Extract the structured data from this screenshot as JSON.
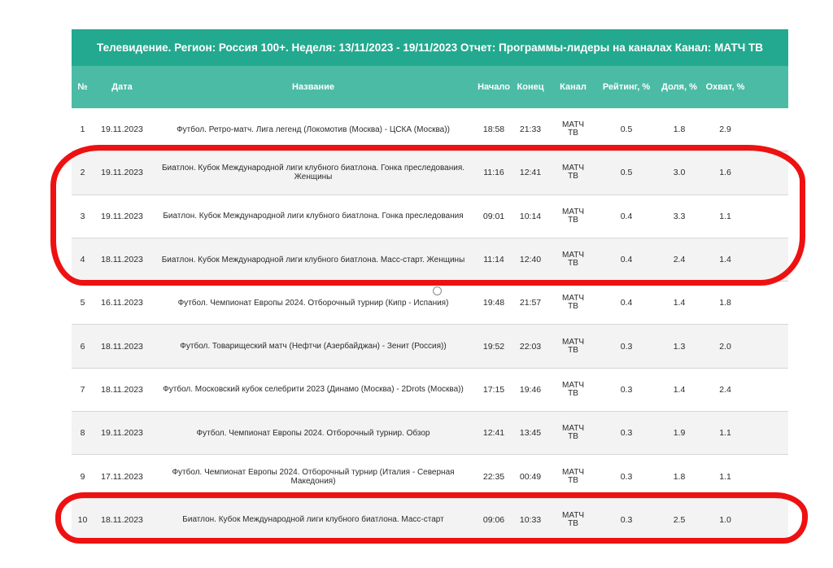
{
  "report": {
    "title": "Телевидение. Регион: Россия 100+. Неделя: 13/11/2023 - 19/11/2023 Отчет: Программы-лидеры на каналах Канал: МАТЧ ТВ"
  },
  "columns": {
    "num": "№",
    "date": "Дата",
    "name": "Название",
    "start": "Начало",
    "end": "Конец",
    "channel": "Канал",
    "rating": "Рейтинг, %",
    "share": "Доля, %",
    "reach": "Охват, %"
  },
  "rows": [
    {
      "num": "1",
      "date": "19.11.2023",
      "name": "Футбол. Ретро-матч. Лига легенд (Локомотив (Москва) - ЦСКА (Москва))",
      "start": "18:58",
      "end": "21:33",
      "channel": "МАТЧ ТВ",
      "rating": "0.5",
      "share": "1.8",
      "reach": "2.9"
    },
    {
      "num": "2",
      "date": "19.11.2023",
      "name": "Биатлон. Кубок Международной лиги клубного биатлона. Гонка преследования. Женщины",
      "start": "11:16",
      "end": "12:41",
      "channel": "МАТЧ ТВ",
      "rating": "0.5",
      "share": "3.0",
      "reach": "1.6"
    },
    {
      "num": "3",
      "date": "19.11.2023",
      "name": "Биатлон. Кубок Международной лиги клубного биатлона. Гонка преследования",
      "start": "09:01",
      "end": "10:14",
      "channel": "МАТЧ ТВ",
      "rating": "0.4",
      "share": "3.3",
      "reach": "1.1"
    },
    {
      "num": "4",
      "date": "18.11.2023",
      "name": "Биатлон. Кубок Международной лиги клубного биатлона. Масс-старт. Женщины",
      "start": "11:14",
      "end": "12:40",
      "channel": "МАТЧ ТВ",
      "rating": "0.4",
      "share": "2.4",
      "reach": "1.4"
    },
    {
      "num": "5",
      "date": "16.11.2023",
      "name": "Футбол. Чемпионат Европы 2024. Отборочный турнир (Кипр - Испания)",
      "start": "19:48",
      "end": "21:57",
      "channel": "МАТЧ ТВ",
      "rating": "0.4",
      "share": "1.4",
      "reach": "1.8"
    },
    {
      "num": "6",
      "date": "18.11.2023",
      "name": "Футбол. Товарищеский матч (Нефтчи (Азербайджан) - Зенит (Россия))",
      "start": "19:52",
      "end": "22:03",
      "channel": "МАТЧ ТВ",
      "rating": "0.3",
      "share": "1.3",
      "reach": "2.0"
    },
    {
      "num": "7",
      "date": "18.11.2023",
      "name": "Футбол. Московский кубок селебрити 2023 (Динамо (Москва) - 2Drots (Москва))",
      "start": "17:15",
      "end": "19:46",
      "channel": "МАТЧ ТВ",
      "rating": "0.3",
      "share": "1.4",
      "reach": "2.4"
    },
    {
      "num": "8",
      "date": "19.11.2023",
      "name": "Футбол. Чемпионат Европы 2024. Отборочный турнир. Обзор",
      "start": "12:41",
      "end": "13:45",
      "channel": "МАТЧ ТВ",
      "rating": "0.3",
      "share": "1.9",
      "reach": "1.1"
    },
    {
      "num": "9",
      "date": "17.11.2023",
      "name": "Футбол. Чемпионат Европы 2024. Отборочный турнир (Италия - Северная Македония)",
      "start": "22:35",
      "end": "00:49",
      "channel": "МАТЧ ТВ",
      "rating": "0.3",
      "share": "1.8",
      "reach": "1.1"
    },
    {
      "num": "10",
      "date": "18.11.2023",
      "name": "Биатлон. Кубок Международной лиги клубного биатлона. Масс-старт",
      "start": "09:06",
      "end": "10:33",
      "channel": "МАТЧ ТВ",
      "rating": "0.3",
      "share": "2.5",
      "reach": "1.0"
    }
  ],
  "colors": {
    "title_bg": "#23a98f",
    "header_bg": "#4bbba6",
    "highlight": "#ee1111"
  }
}
